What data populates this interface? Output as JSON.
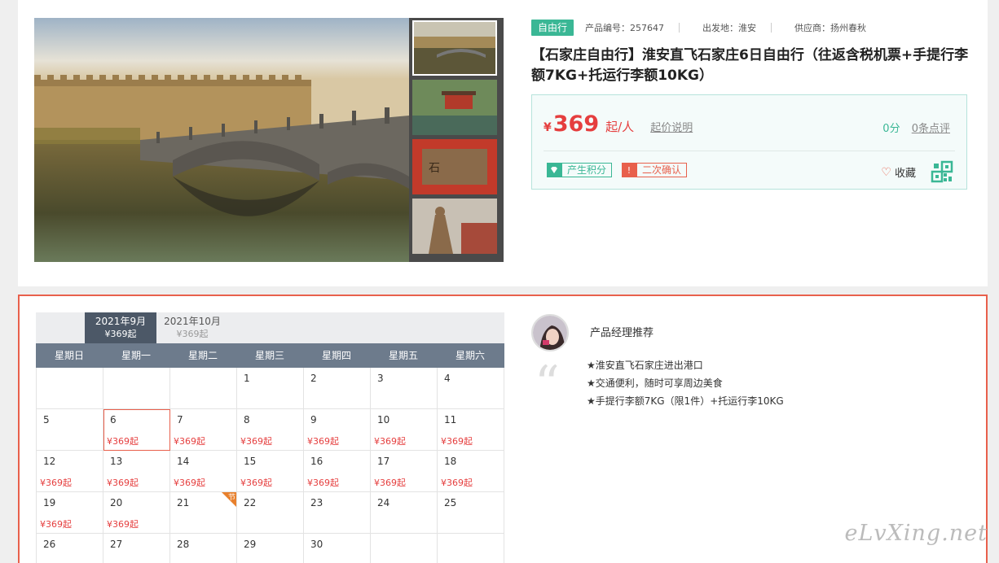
{
  "product": {
    "tag": "自由行",
    "code": "产品编号：257647",
    "departure": "出发地：淮安",
    "supplier": "供应商：扬州春秋",
    "title": "【石家庄自由行】淮安直飞石家庄6日自由行（往返含税机票+手提行李额7KG+托运行李额10KG）"
  },
  "price": {
    "currency": "¥",
    "amount": "369",
    "per": "起/人",
    "note": "起价说明",
    "score": "0分",
    "reviews": "0条点评"
  },
  "badges": [
    {
      "icon": "diamond-icon",
      "label": "产生积分"
    },
    {
      "icon": "alert-icon",
      "label": "二次确认"
    }
  ],
  "favorite": "收藏",
  "calendar": {
    "months": [
      {
        "label": "2021年9月",
        "price": "¥369起"
      },
      {
        "label": "2021年10月",
        "price": "¥369起"
      }
    ],
    "weekdays": [
      "星期日",
      "星期一",
      "星期二",
      "星期三",
      "星期四",
      "星期五",
      "星期六"
    ],
    "days": [
      {
        "d": "",
        "p": ""
      },
      {
        "d": "",
        "p": ""
      },
      {
        "d": "",
        "p": ""
      },
      {
        "d": "1",
        "p": ""
      },
      {
        "d": "2",
        "p": ""
      },
      {
        "d": "3",
        "p": ""
      },
      {
        "d": "4",
        "p": ""
      },
      {
        "d": "5",
        "p": ""
      },
      {
        "d": "6",
        "p": "¥369起",
        "sel": true
      },
      {
        "d": "7",
        "p": "¥369起"
      },
      {
        "d": "8",
        "p": "¥369起"
      },
      {
        "d": "9",
        "p": "¥369起"
      },
      {
        "d": "10",
        "p": "¥369起"
      },
      {
        "d": "11",
        "p": "¥369起"
      },
      {
        "d": "12",
        "p": "¥369起"
      },
      {
        "d": "13",
        "p": "¥369起"
      },
      {
        "d": "14",
        "p": "¥369起"
      },
      {
        "d": "15",
        "p": "¥369起"
      },
      {
        "d": "16",
        "p": "¥369起"
      },
      {
        "d": "17",
        "p": "¥369起"
      },
      {
        "d": "18",
        "p": "¥369起"
      },
      {
        "d": "19",
        "p": "¥369起"
      },
      {
        "d": "20",
        "p": "¥369起"
      },
      {
        "d": "21",
        "p": "",
        "holiday": "节"
      },
      {
        "d": "22",
        "p": ""
      },
      {
        "d": "23",
        "p": ""
      },
      {
        "d": "24",
        "p": ""
      },
      {
        "d": "25",
        "p": ""
      },
      {
        "d": "26",
        "p": ""
      },
      {
        "d": "27",
        "p": ""
      },
      {
        "d": "28",
        "p": ""
      },
      {
        "d": "29",
        "p": ""
      },
      {
        "d": "30",
        "p": ""
      },
      {
        "d": "",
        "p": ""
      },
      {
        "d": "",
        "p": ""
      }
    ]
  },
  "manager": {
    "title": "产品经理推荐",
    "points": [
      "★淮安直飞石家庄进出港口",
      "★交通便利，随时可享周边美食",
      "★手提行李额7KG（限1件）+托运行李10KG"
    ]
  },
  "watermark": "eLvXing.net",
  "colors": {
    "accent": "#3ab795",
    "price": "#e53e3e",
    "border": "#e8604c"
  }
}
